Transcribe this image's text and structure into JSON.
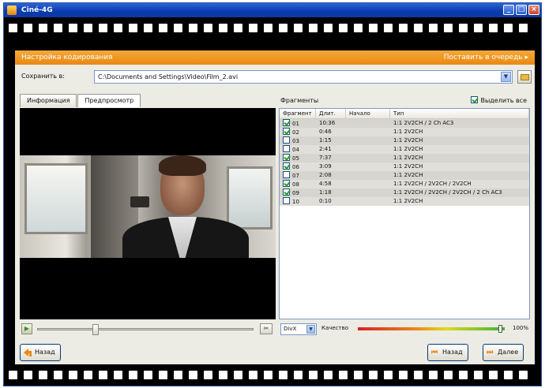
{
  "window": {
    "title": "Ciné-4G",
    "controls": [
      "_",
      "□",
      "×"
    ]
  },
  "header": {
    "title": "Настройка кодирования",
    "right": "Поставить в очередь ▸"
  },
  "destination": {
    "label": "Сохранить в:",
    "value": "C:\\Documents and Settings\\Video\\Film_2.avi"
  },
  "left": {
    "tabs": [
      "Информация",
      "Предпросмотр"
    ],
    "active_tab": 1,
    "seek_position": 0.27
  },
  "right": {
    "title": "Фрагменты",
    "check_all_label": "Выделить все",
    "columns": [
      "Фрагмент",
      "Длит.",
      "Начало",
      "Тип"
    ],
    "rows": [
      {
        "c1": "01",
        "c2": "10:36",
        "c3": "",
        "c4": "1:1 2V2CH / 2 Ch AC3"
      },
      {
        "c1": "02",
        "c2": "0:46",
        "c3": "",
        "c4": "1:1 2V2CH"
      },
      {
        "c1": "03",
        "c2": "1:15",
        "c3": "",
        "c4": "1:1 2V2CH"
      },
      {
        "c1": "04",
        "c2": "2:41",
        "c3": "",
        "c4": "1:1 2V2CH"
      },
      {
        "c1": "05",
        "c2": "7:37",
        "c3": "",
        "c4": "1:1 2V2CH"
      },
      {
        "c1": "06",
        "c2": "3:09",
        "c3": "",
        "c4": "1:1 2V2CH"
      },
      {
        "c1": "07",
        "c2": "2:08",
        "c3": "",
        "c4": "1:1 2V2CH"
      },
      {
        "c1": "08",
        "c2": "4:58",
        "c3": "",
        "c4": "1:1 2V2CH / 2V2CH / 2V2CH"
      },
      {
        "c1": "09",
        "c2": "1:18",
        "c3": "",
        "c4": "1:1 2V2CH / 2V2CH / 2V2CH / 2 Ch AC3"
      },
      {
        "c1": "10",
        "c2": "0:10",
        "c3": "",
        "c4": "1:1 2V2CH"
      }
    ],
    "row_checked": [
      true,
      true,
      false,
      false,
      true,
      true,
      false,
      true,
      true,
      false
    ],
    "quality_combo": "DivX",
    "quality_label": "Качество",
    "quality_value": 0.97,
    "quality_pct": "100%"
  },
  "footer": {
    "back": "Назад",
    "prev": "Назад",
    "next": "Далее"
  }
}
